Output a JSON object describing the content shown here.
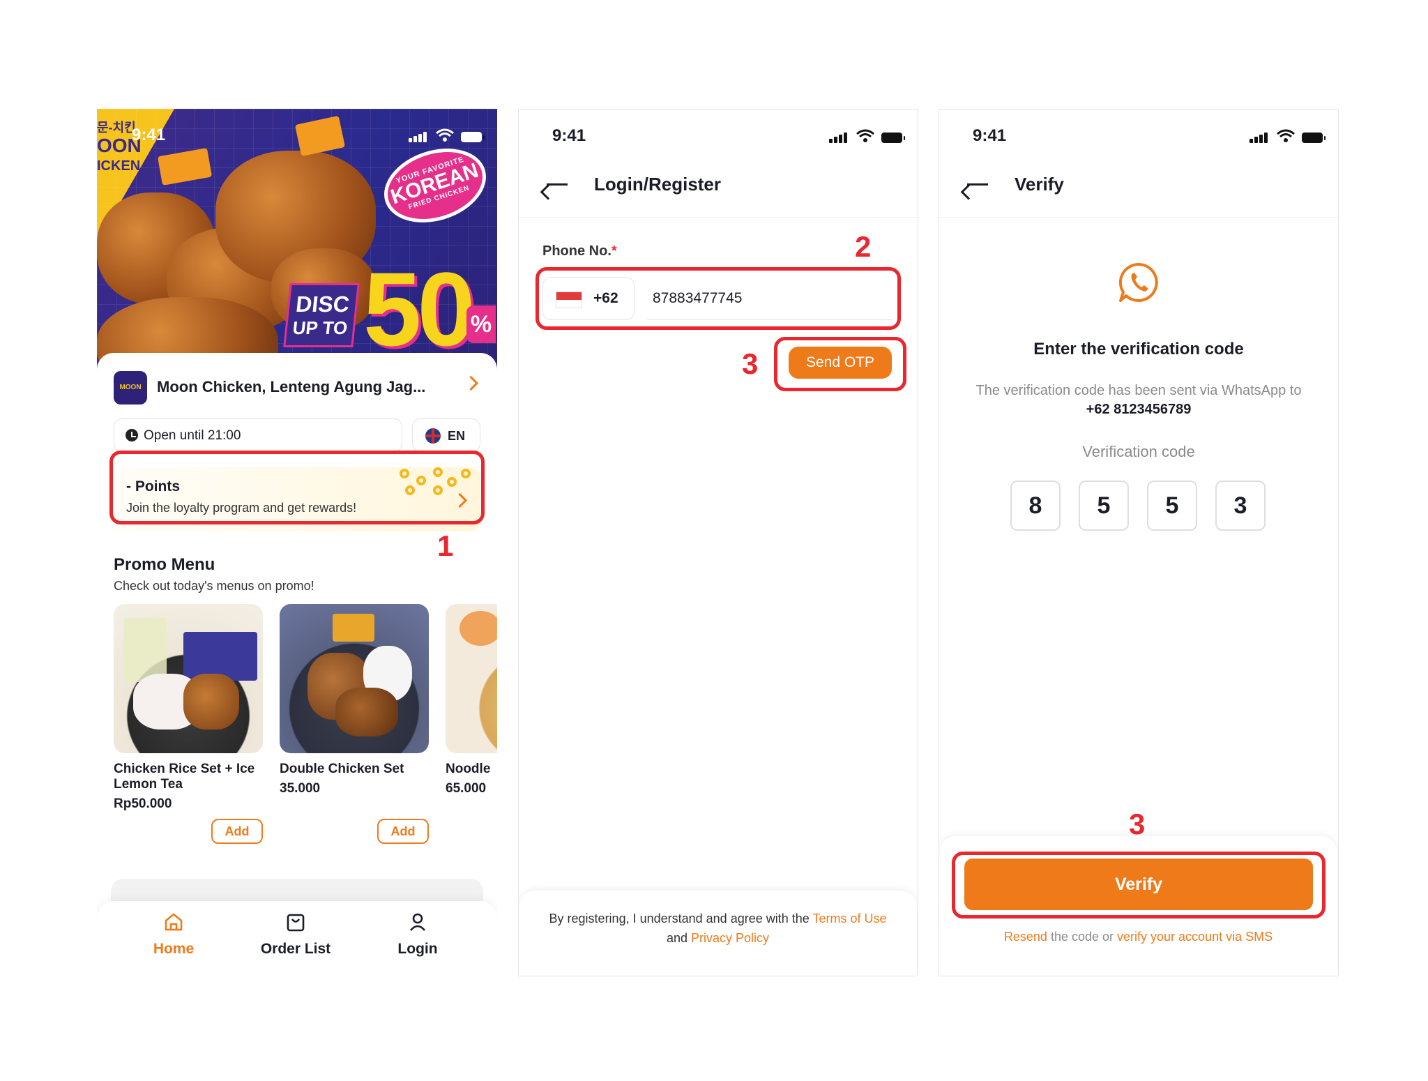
{
  "status_bar": {
    "time": "9:41"
  },
  "screen_home": {
    "banner": {
      "brand_small": "문-치킨",
      "brand": "OON",
      "brand2": "ICKEN",
      "tag_line1": "YOUR FAVORITE",
      "tag_line2": "KOREAN",
      "tag_line3": "FRIED CHICKEN",
      "disc": "DISC",
      "upto": "UP TO",
      "value": "50",
      "percent": "%"
    },
    "store": {
      "logo_text": "MOON",
      "name": "Moon Chicken, Lenteng Agung Jag..."
    },
    "open_hours": "Open until 21:00",
    "language": "EN",
    "points": {
      "title": "- Points",
      "subtitle": "Join the loyalty program and get rewards!"
    },
    "promo": {
      "title": "Promo Menu",
      "subtitle": "Check out today's menus on promo!",
      "items": [
        {
          "name": "Chicken Rice Set + Ice Lemon Tea",
          "price": "Rp50.000",
          "add": "Add"
        },
        {
          "name": "Double Chicken Set",
          "price": "35.000",
          "add": "Add"
        },
        {
          "name": "Noodle",
          "price": "65.000"
        }
      ]
    },
    "nav": [
      {
        "label": "Home",
        "icon": "home-icon",
        "active": true
      },
      {
        "label": "Order List",
        "icon": "bag-icon",
        "active": false
      },
      {
        "label": "Login",
        "icon": "user-icon",
        "active": false
      }
    ]
  },
  "screen_login": {
    "title": "Login/Register",
    "phone_label": "Phone No.",
    "required_mark": "*",
    "country_code": "+62",
    "phone_value": "87883477745",
    "send_otp": "Send OTP",
    "terms_prefix": "By registering, I understand and agree with the ",
    "terms_link": "Terms of Use",
    "terms_and": " and ",
    "privacy_link": "Privacy Policy"
  },
  "screen_verify": {
    "title": "Verify",
    "heading": "Enter the verification code",
    "desc": "The verification code has been sent via WhatsApp to ",
    "phone": "+62 8123456789",
    "code_label": "Verification code",
    "code": [
      "8",
      "5",
      "5",
      "3"
    ],
    "verify_button": "Verify",
    "resend_link": "Resend",
    "resend_mid": " the code or ",
    "sms_link": "verify your account via SMS"
  },
  "annotations": [
    "1",
    "2",
    "3",
    "3"
  ],
  "colors": {
    "accent": "#ef7a1a",
    "highlight": "#e8272f",
    "text": "#1c1c28"
  }
}
